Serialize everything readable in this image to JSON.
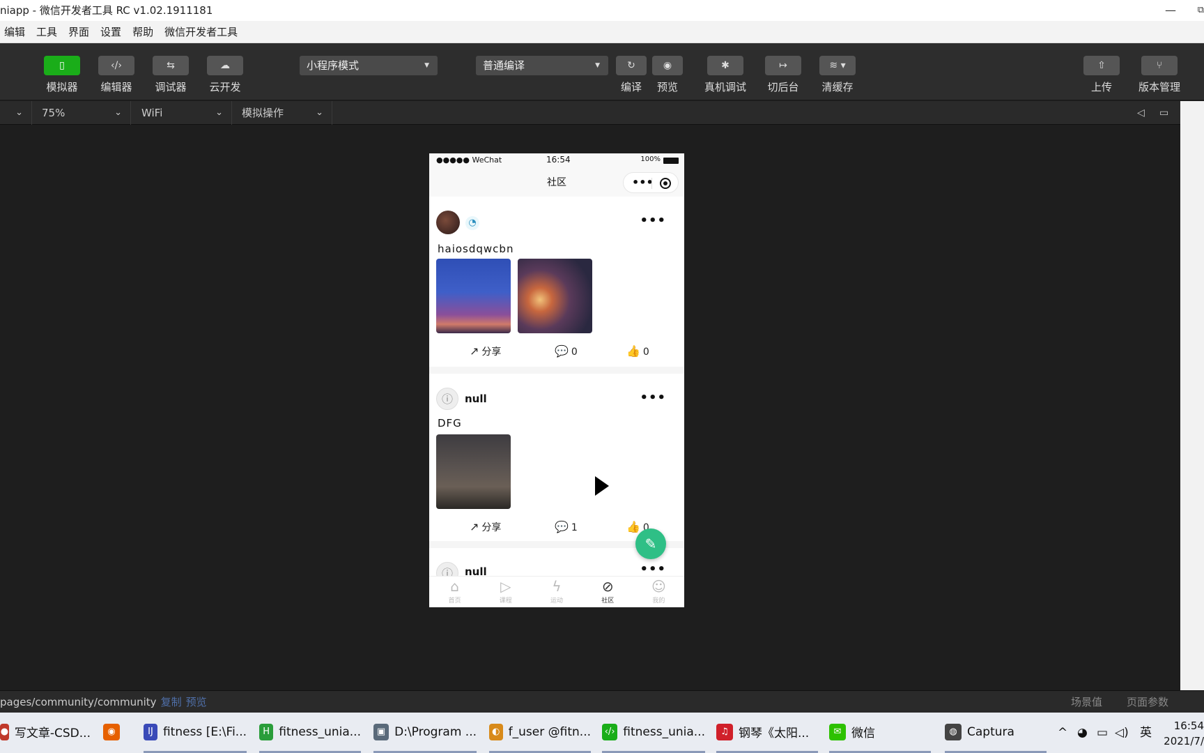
{
  "window": {
    "title": "niapp - 微信开发者工具 RC v1.02.1911181",
    "min": "—",
    "max": "⧉"
  },
  "menu": [
    "编辑",
    "工具",
    "界面",
    "设置",
    "帮助",
    "微信开发者工具"
  ],
  "toolbar": {
    "simulator": "模拟器",
    "editor": "编辑器",
    "debugger": "调试器",
    "cloud": "云开发",
    "mode_select": "小程序模式",
    "compile_select": "普通编译",
    "compile": "编译",
    "preview": "预览",
    "remote_debug": "真机调试",
    "background": "切后台",
    "clear_cache": "清缓存",
    "upload": "上传",
    "version": "版本管理"
  },
  "subbar": {
    "zoom": "75%",
    "network": "WiFi",
    "sim_ops": "模拟操作"
  },
  "phone": {
    "status": {
      "carrier": "●●●●● WeChat",
      "time": "16:54",
      "battery": "100%"
    },
    "nav_title": "社区",
    "posts": [
      {
        "username": "",
        "text": "haiosdqwcbn",
        "share": "分享",
        "comments": "0",
        "likes": "0"
      },
      {
        "username": "null",
        "text": "DFG",
        "share": "分享",
        "comments": "1",
        "likes": "0"
      },
      {
        "username": "null"
      }
    ],
    "tabs": [
      {
        "label": "首页",
        "icon": "home-icon"
      },
      {
        "label": "课程",
        "icon": "play-icon"
      },
      {
        "label": "运动",
        "icon": "lightning-icon"
      },
      {
        "label": "社区",
        "icon": "planet-icon"
      },
      {
        "label": "我的",
        "icon": "smile-icon"
      }
    ]
  },
  "bottom": {
    "path": "pages/community/community",
    "copy": "复制",
    "preview": "预览",
    "scene": "场景值",
    "params": "页面参数"
  },
  "taskbar": {
    "items": [
      {
        "label": "写文章-CSD...",
        "color": "#c0392b"
      },
      {
        "label": "",
        "color": "#e66000"
      },
      {
        "label": "fitness [E:\\Fi...",
        "color": "#3a4ab8"
      },
      {
        "label": "fitness_unia...",
        "color": "#2a9d3a"
      },
      {
        "label": "D:\\Program ...",
        "color": "#5a6a7a"
      },
      {
        "label": "f_user @fitn...",
        "color": "#d88a1a"
      },
      {
        "label": "fitness_unia...",
        "color": "#1aad19"
      },
      {
        "label": "钢琴《太阳...",
        "color": "#d0202a"
      },
      {
        "label": "微信",
        "color": "#2dc100"
      },
      {
        "label": "Captura",
        "color": "#444"
      }
    ],
    "ime": "英",
    "time": "16:54",
    "date": "2021/7/"
  }
}
